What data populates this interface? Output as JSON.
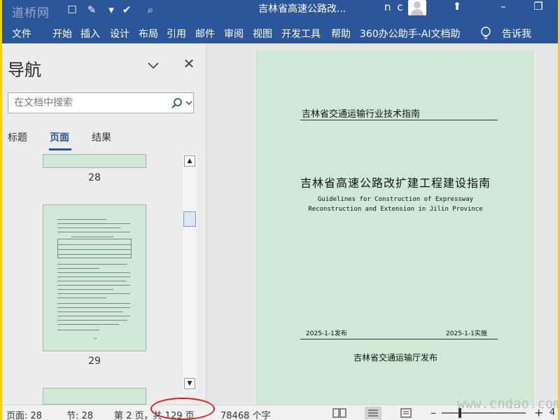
{
  "titlebar": {
    "watermark": "道桥网",
    "doc_title": "吉林省高速公路改...",
    "user_initials": "n c"
  },
  "ribbon": {
    "tabs": [
      "文件",
      "开始",
      "插入",
      "设计",
      "布局",
      "引用",
      "邮件",
      "审阅",
      "视图",
      "开发工具",
      "帮助",
      "360办公助手-AI文档助"
    ],
    "tell_me": "告诉我"
  },
  "nav": {
    "title": "导航",
    "search_placeholder": "在文档中搜索",
    "tabs": {
      "headings": "标题",
      "pages": "页面",
      "results": "结果"
    },
    "active_tab": "pages",
    "thumbnails": [
      {
        "page": "28"
      },
      {
        "page": "29"
      }
    ]
  },
  "document": {
    "header_text": "吉林省交通运输行业技术指南",
    "main_title": "吉林省高速公路改扩建工程建设指南",
    "english_title_line1": "Guidelines for Construction of Expressway",
    "english_title_line2": "Reconstruction and Extension in Jilin  Province",
    "publish_date": "2025-1-1发布",
    "implement_date": "2025-1-1实施",
    "publisher": "吉林省交通运输厅发布"
  },
  "status": {
    "page": "页面: 28",
    "section": "节: 28",
    "page_of": "第 2 页，共 129 页",
    "word_count": "78468 个字",
    "zoom": "4"
  },
  "watermark_right": "www.cndao.com",
  "colors": {
    "ribbon": "#2b579a",
    "page_bg": "#cfe9d4",
    "highlight_circle": "#e0201c",
    "frame_border": "#f3d400"
  }
}
